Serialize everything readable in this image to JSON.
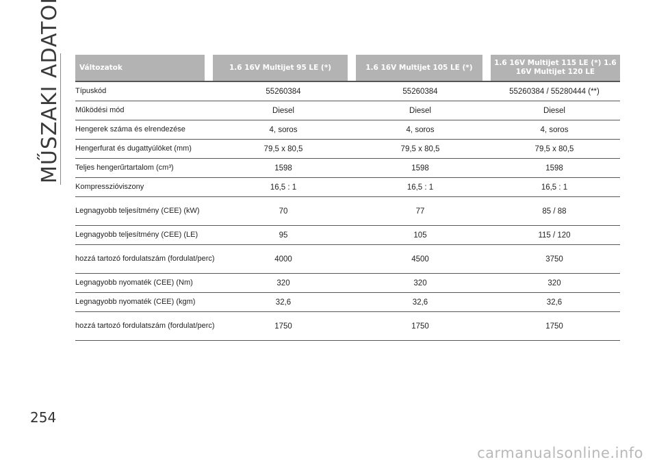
{
  "side_title": "MŰSZAKI ADATOK",
  "page_number": "254",
  "watermark": "carmanualsonline.info",
  "table": {
    "headers": [
      "Változatok",
      "1.6 16V Multijet 95 LE (*)",
      "1.6 16V Multijet 105 LE (*)",
      "1.6 16V Multijet 115 LE (*) 1.6 16V Multijet 120 LE"
    ],
    "rows": [
      {
        "label": "Típuskód",
        "v1": "55260384",
        "v2": "55260384",
        "v3": "55260384 / 55280444 (**)"
      },
      {
        "label": "Működési mód",
        "v1": "Diesel",
        "v2": "Diesel",
        "v3": "Diesel"
      },
      {
        "label": "Hengerek száma és elrendezése",
        "v1": "4, soros",
        "v2": "4, soros",
        "v3": "4, soros"
      },
      {
        "label": "Hengerfurat és dugattyúlöket (mm)",
        "v1": "79,5 x 80,5",
        "v2": "79,5 x 80,5",
        "v3": "79,5 x 80,5"
      },
      {
        "label": "Teljes hengerűrtartalom (cm³)",
        "v1": "1598",
        "v2": "1598",
        "v3": "1598"
      },
      {
        "label": "Kompresszióviszony",
        "v1": "16,5 : 1",
        "v2": "16,5 : 1",
        "v3": "16,5 : 1"
      },
      {
        "label": "Legnagyobb teljesítmény (CEE) (kW)",
        "v1": "70",
        "v2": "77",
        "v3": "85 / 88"
      },
      {
        "label": "Legnagyobb teljesítmény (CEE) (LE)",
        "v1": "95",
        "v2": "105",
        "v3": "115 / 120"
      },
      {
        "label": "hozzá tartozó fordulatszám (fordulat/perc)",
        "v1": "4000",
        "v2": "4500",
        "v3": "3750"
      },
      {
        "label": "Legnagyobb nyomaték (CEE) (Nm)",
        "v1": "320",
        "v2": "320",
        "v3": "320"
      },
      {
        "label": "Legnagyobb nyomaték (CEE) (kgm)",
        "v1": "32,6",
        "v2": "32,6",
        "v3": "32,6"
      },
      {
        "label": "hozzá tartozó fordulatszám (fordulat/perc)",
        "v1": "1750",
        "v2": "1750",
        "v3": "1750"
      }
    ]
  }
}
